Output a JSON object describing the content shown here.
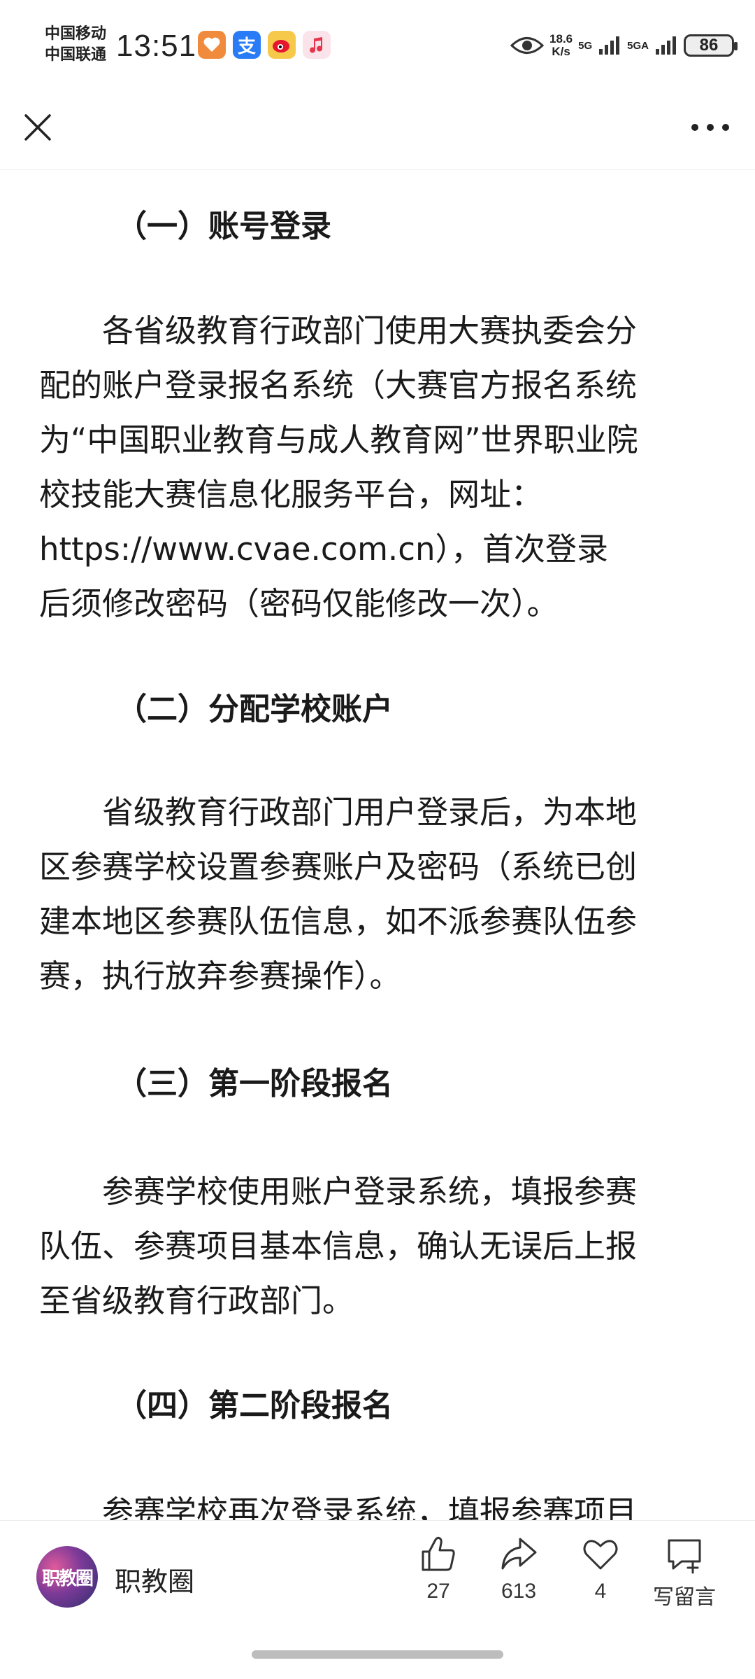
{
  "status_bar": {
    "carrier_1": "中国移动",
    "carrier_2": "中国联通",
    "time": "13:51",
    "net_speed_value": "18.6",
    "net_speed_unit": "K/s",
    "net_1": "5G",
    "net_2": "5GA",
    "battery": "86"
  },
  "article": {
    "sections": [
      {
        "heading": "（一）账号登录",
        "lines": [
          "各省级教育行政部门使用大赛执委会分",
          "配的账户登录报名系统（大赛官方报名系统",
          "为“中国职业教育与成人教育网”世界职业院",
          "校技能大赛信息化服务平台，网址：",
          "https://www.cvae.com.cn），首次登录",
          "后须修改密码（密码仅能修改一次）。"
        ]
      },
      {
        "heading": "（二）分配学校账户",
        "lines": [
          "省级教育行政部门用户登录后，为本地",
          "区参赛学校设置参赛账户及密码（系统已创",
          "建本地区参赛队伍信息，如不派参赛队伍参",
          "赛，执行放弃参赛操作）。"
        ]
      },
      {
        "heading": "（三）第一阶段报名",
        "lines": [
          "参赛学校使用账户登录系统，填报参赛",
          "队伍、参赛项目基本信息，确认无误后上报",
          "至省级教育行政部门。"
        ]
      },
      {
        "heading": "（四）第二阶段报名",
        "lines": [
          "参赛学校再次登录系统，填报参赛项目"
        ]
      }
    ]
  },
  "bottom_bar": {
    "avatar_text": "职教圈",
    "account_name": "职教圈",
    "like_count": "27",
    "share_count": "613",
    "favorite_count": "4",
    "comment_label": "写留言"
  }
}
